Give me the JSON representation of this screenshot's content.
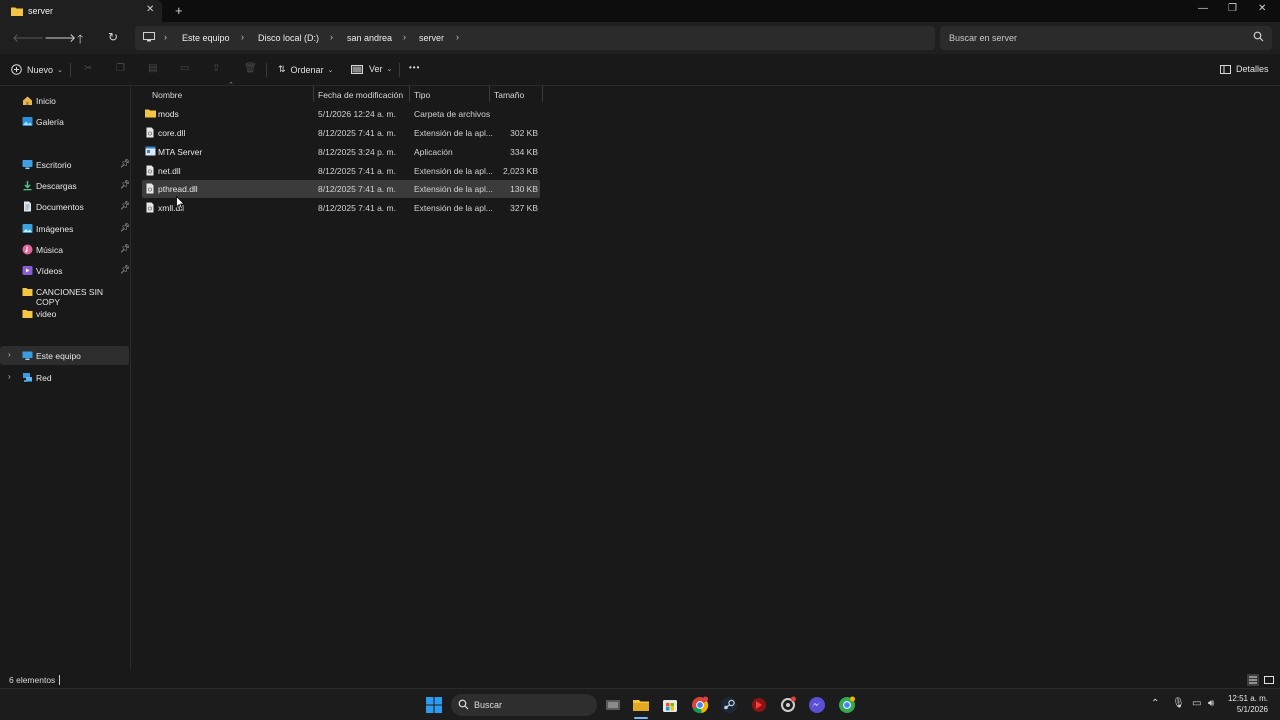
{
  "window": {
    "tab_title": "server",
    "new_tab": "+",
    "close_tab": "✕",
    "minimize": "—",
    "maximize": "❐",
    "close": "✕"
  },
  "addressbar": {
    "breadcrumbs": [
      "Este equipo",
      "Disco local (D:)",
      "san andrea",
      "server"
    ],
    "search_placeholder": "Buscar en server"
  },
  "commandbar": {
    "new_label": "Nuevo",
    "sort_label": "Ordenar",
    "view_label": "Ver",
    "more_label": "•••",
    "details_label": "Detalles"
  },
  "sidebar": {
    "items": [
      {
        "label": "Inicio",
        "icon": "home-icon",
        "pinned": false
      },
      {
        "label": "Galería",
        "icon": "gallery-icon",
        "pinned": false
      },
      {
        "label": "Escritorio",
        "icon": "desktop-icon",
        "pinned": true
      },
      {
        "label": "Descargas",
        "icon": "downloads-icon",
        "pinned": true
      },
      {
        "label": "Documentos",
        "icon": "documents-icon",
        "pinned": true
      },
      {
        "label": "Imágenes",
        "icon": "pictures-icon",
        "pinned": true
      },
      {
        "label": "Música",
        "icon": "music-icon",
        "pinned": true
      },
      {
        "label": "Vídeos",
        "icon": "videos-icon",
        "pinned": true
      },
      {
        "label": "CANCIONES SIN COPY",
        "icon": "folder-icon",
        "pinned": false
      },
      {
        "label": "video",
        "icon": "folder-icon",
        "pinned": false
      },
      {
        "label": "Este equipo",
        "icon": "this-pc-icon",
        "pinned": false
      },
      {
        "label": "Red",
        "icon": "network-icon",
        "pinned": false
      }
    ]
  },
  "filelist": {
    "columns": [
      "Nombre",
      "Fecha de modificación",
      "Tipo",
      "Tamaño"
    ],
    "rows": [
      {
        "name": "mods",
        "date": "5/1/2026 12:24 a. m.",
        "type": "Carpeta de archivos",
        "size": "",
        "icon": "folder-icon"
      },
      {
        "name": "core.dll",
        "date": "8/12/2025 7:41 a. m.",
        "type": "Extensión de la apl...",
        "size": "302 KB",
        "icon": "dll-file-icon"
      },
      {
        "name": "MTA Server",
        "date": "8/12/2025 3:24 p. m.",
        "type": "Aplicación",
        "size": "334 KB",
        "icon": "application-icon"
      },
      {
        "name": "net.dll",
        "date": "8/12/2025 7:41 a. m.",
        "type": "Extensión de la apl...",
        "size": "2,023 KB",
        "icon": "dll-file-icon"
      },
      {
        "name": "pthread.dll",
        "date": "8/12/2025 7:41 a. m.",
        "type": "Extensión de la apl...",
        "size": "130 KB",
        "icon": "dll-file-icon"
      },
      {
        "name": "xmll.dll",
        "date": "8/12/2025 7:41 a. m.",
        "type": "Extensión de la apl...",
        "size": "327 KB",
        "icon": "dll-file-icon"
      }
    ]
  },
  "status": {
    "count": "6 elementos"
  },
  "taskbar": {
    "search_label": "Buscar",
    "time": "12:51 a. m.",
    "date": "5/1/2026"
  }
}
